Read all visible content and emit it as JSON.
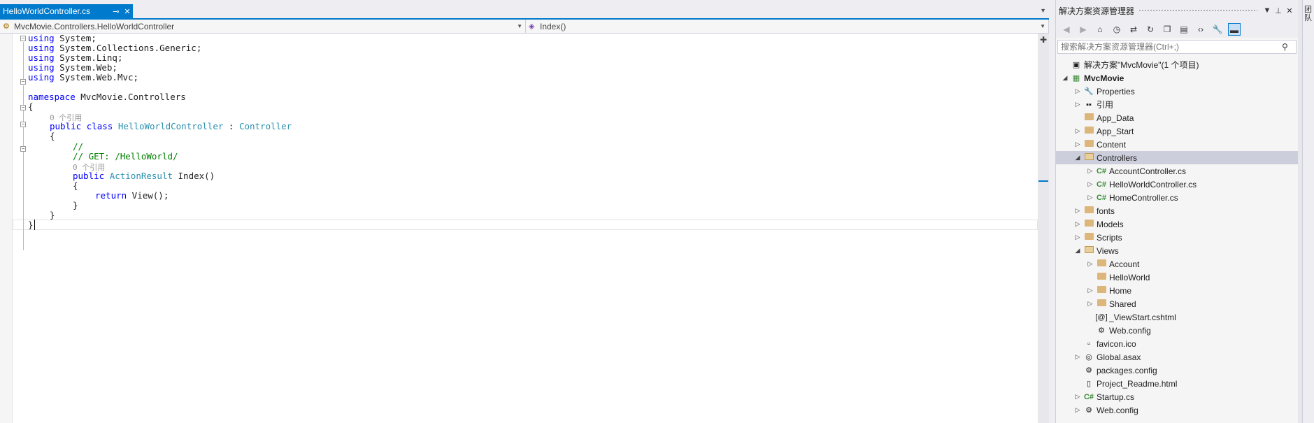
{
  "editor": {
    "tab_title": "HelloWorldController.cs",
    "nav_left": "MvcMovie.Controllers.HelloWorldController",
    "nav_right": "Index()",
    "code": {
      "l1": [
        "using",
        " System;"
      ],
      "l2": [
        "using",
        " System.Collections.Generic;"
      ],
      "l3": [
        "using",
        " System.Linq;"
      ],
      "l4": [
        "using",
        " System.Web;"
      ],
      "l5": [
        "using",
        " System.Web.Mvc;"
      ],
      "ns_kw": "namespace",
      "ns_name": " MvcMovie.Controllers",
      "brace_open": "{",
      "brace_close": "}",
      "ref_count": "0 个引用",
      "public": "public",
      "class": "class",
      "class_name": "HelloWorldController",
      "colon": " : ",
      "base_class": "Controller",
      "comment1": "//",
      "comment2": "// GET: /HelloWorld/",
      "return_type": "ActionResult",
      "method": " Index()",
      "return_kw": "return",
      "return_expr": " View();",
      "last_brace": "}"
    }
  },
  "solution_explorer": {
    "title": "解决方案资源管理器",
    "search_placeholder": "搜索解决方案资源管理器(Ctrl+;)",
    "items": [
      {
        "label": "解决方案\"MvcMovie\"(1 个项目)"
      },
      {
        "label": "MvcMovie"
      },
      {
        "label": "Properties"
      },
      {
        "label": "引用"
      },
      {
        "label": "App_Data"
      },
      {
        "label": "App_Start"
      },
      {
        "label": "Content"
      },
      {
        "label": "Controllers"
      },
      {
        "label": "AccountController.cs"
      },
      {
        "label": "HelloWorldController.cs"
      },
      {
        "label": "HomeController.cs"
      },
      {
        "label": "fonts"
      },
      {
        "label": "Models"
      },
      {
        "label": "Scripts"
      },
      {
        "label": "Views"
      },
      {
        "label": "Account"
      },
      {
        "label": "HelloWorld"
      },
      {
        "label": "Home"
      },
      {
        "label": "Shared"
      },
      {
        "label": "_ViewStart.cshtml"
      },
      {
        "label": "Web.config"
      },
      {
        "label": "favicon.ico"
      },
      {
        "label": "Global.asax"
      },
      {
        "label": "packages.config"
      },
      {
        "label": "Project_Readme.html"
      },
      {
        "label": "Startup.cs"
      },
      {
        "label": "Web.config"
      }
    ]
  },
  "side_strip": {
    "label": "团队"
  },
  "colors": {
    "accent": "#007acc",
    "keyword": "#0000ff",
    "type": "#2b91af",
    "comment": "#008000"
  }
}
